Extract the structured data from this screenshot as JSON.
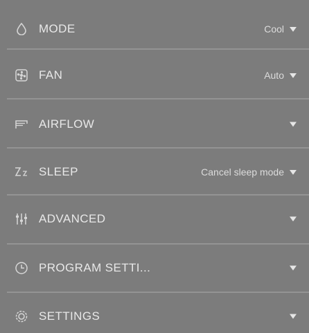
{
  "rows": [
    {
      "key": "mode",
      "label": "MODE",
      "value": "Cool",
      "icon": "droplet-icon"
    },
    {
      "key": "fan",
      "label": "FAN",
      "value": "Auto",
      "icon": "fan-icon"
    },
    {
      "key": "airflow",
      "label": "AIRFLOW",
      "value": "",
      "icon": "airflow-vent-icon"
    },
    {
      "key": "sleep",
      "label": "SLEEP",
      "value": "Cancel sleep mode",
      "icon": "sleep-zz-icon"
    },
    {
      "key": "advanced",
      "label": "ADVANCED",
      "value": "",
      "icon": "sliders-icon"
    },
    {
      "key": "program",
      "label": "PROGRAM SETTI...",
      "value": "",
      "icon": "clock-icon"
    },
    {
      "key": "settings",
      "label": "SETTINGS",
      "value": "",
      "icon": "gear-icon"
    }
  ],
  "colors": {
    "background": "#7c7c7c",
    "text": "#e8e8e8",
    "divider": "#a8a8a8"
  }
}
